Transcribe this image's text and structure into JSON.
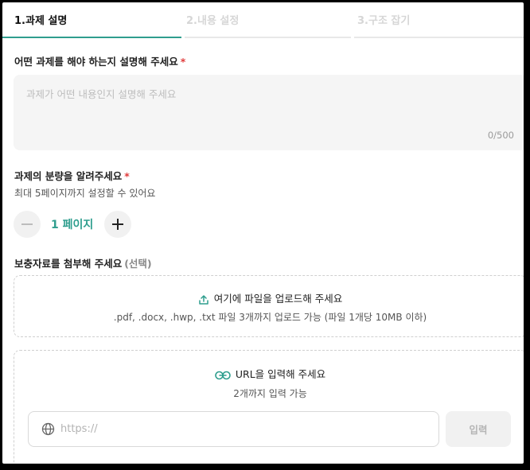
{
  "tabs": [
    {
      "label": "1.과제 설명",
      "active": true
    },
    {
      "label": "2.내용 설정",
      "active": false
    },
    {
      "label": "3.구조 잡기",
      "active": false
    }
  ],
  "description": {
    "label": "어떤 과제를 해야 하는지 설명해 주세요",
    "required_mark": "*",
    "placeholder": "과제가 어떤 내용인지 설명해 주세요",
    "counter": "0/500"
  },
  "amount": {
    "label": "과제의 분량을 알려주세요",
    "required_mark": "*",
    "hint": "최대 5페이지까지 설정할 수 있어요",
    "value": "1 페이지",
    "decrement_icon": "minus-icon",
    "increment_icon": "plus-icon"
  },
  "attachments": {
    "label": "보충자료를 첨부해 주세요",
    "optional": "(선택)",
    "upload": {
      "icon": "upload-icon",
      "title": "여기에 파일을 업로드해 주세요",
      "subtitle": ".pdf, .docx, .hwp, .txt 파일 3개까지 업로드 가능 (파일 1개당 10MB 이하)"
    },
    "url": {
      "icon": "link-icon",
      "title": "URL을 입력해 주세요",
      "subtitle": "2개까지 입력 가능",
      "input_icon": "globe-icon",
      "placeholder": "https://",
      "value": "",
      "submit_label": "입력"
    }
  },
  "colors": {
    "accent": "#2f9e8e",
    "required": "#e03b3b",
    "muted_bg": "#f5f5f5"
  }
}
